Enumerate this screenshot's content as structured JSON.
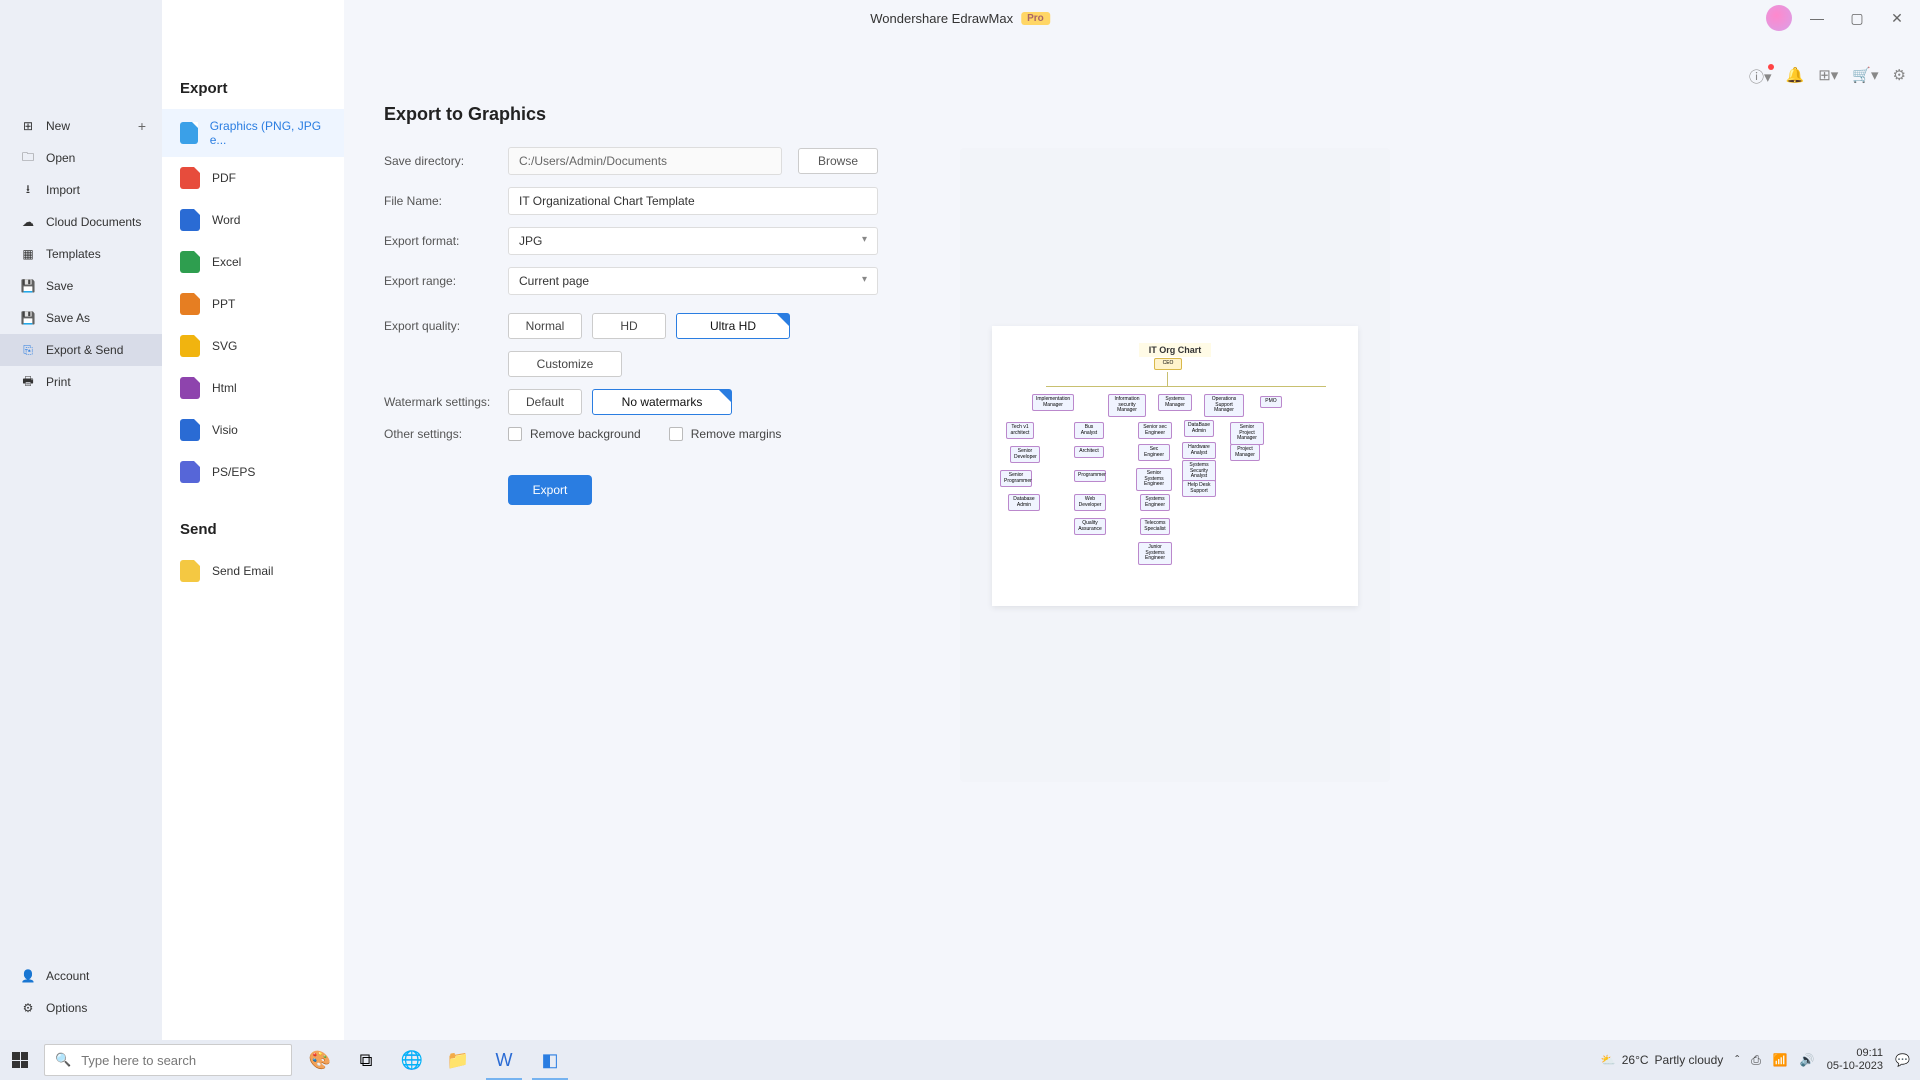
{
  "titlebar": {
    "app_name": "Wondershare EdrawMax",
    "badge": "Pro"
  },
  "back_aria": "Back",
  "sidebar_left": {
    "items": [
      {
        "icon": "plus-square",
        "label": "New",
        "has_plus": true
      },
      {
        "icon": "folder",
        "label": "Open"
      },
      {
        "icon": "import",
        "label": "Import"
      },
      {
        "icon": "cloud",
        "label": "Cloud Documents"
      },
      {
        "icon": "template",
        "label": "Templates"
      },
      {
        "icon": "save",
        "label": "Save"
      },
      {
        "icon": "save-as",
        "label": "Save As"
      },
      {
        "icon": "export",
        "label": "Export & Send",
        "active": true
      },
      {
        "icon": "print",
        "label": "Print"
      }
    ],
    "bottom": [
      {
        "icon": "account",
        "label": "Account"
      },
      {
        "icon": "gear",
        "label": "Options"
      }
    ]
  },
  "sidebar_mid": {
    "export_header": "Export",
    "send_header": "Send",
    "formats": [
      {
        "label": "Graphics (PNG, JPG e...",
        "color": "#3aa0e8",
        "active": true
      },
      {
        "label": "PDF",
        "color": "#e74c3c"
      },
      {
        "label": "Word",
        "color": "#2a6bd4"
      },
      {
        "label": "Excel",
        "color": "#2e9e4f"
      },
      {
        "label": "PPT",
        "color": "#e67e22"
      },
      {
        "label": "SVG",
        "color": "#f1b40f"
      },
      {
        "label": "Html",
        "color": "#8e44ad"
      },
      {
        "label": "Visio",
        "color": "#2a6bd4"
      },
      {
        "label": "PS/EPS",
        "color": "#5666d8"
      }
    ],
    "send_items": [
      {
        "label": "Send Email",
        "color": "#f4c842"
      }
    ]
  },
  "main": {
    "title": "Export to Graphics",
    "labels": {
      "save_directory": "Save directory:",
      "file_name": "File Name:",
      "export_format": "Export format:",
      "export_range": "Export range:",
      "export_quality": "Export quality:",
      "watermark_settings": "Watermark settings:",
      "other_settings": "Other settings:"
    },
    "values": {
      "save_directory": "C:/Users/Admin/Documents",
      "file_name": "IT Organizational Chart Template",
      "export_format": "JPG",
      "export_range": "Current page"
    },
    "browse": "Browse",
    "quality": {
      "normal": "Normal",
      "hd": "HD",
      "ultra": "Ultra HD"
    },
    "customize": "Customize",
    "watermark": {
      "default": "Default",
      "none": "No watermarks"
    },
    "checkboxes": {
      "remove_bg": "Remove background",
      "remove_margins": "Remove margins"
    },
    "export_button": "Export"
  },
  "preview": {
    "title": "IT Org Chart",
    "ceo": "CEO"
  },
  "taskbar": {
    "search_placeholder": "Type here to search",
    "weather_temp": "26°C",
    "weather_text": "Partly cloudy",
    "time": "09:11",
    "date": "05-10-2023"
  }
}
